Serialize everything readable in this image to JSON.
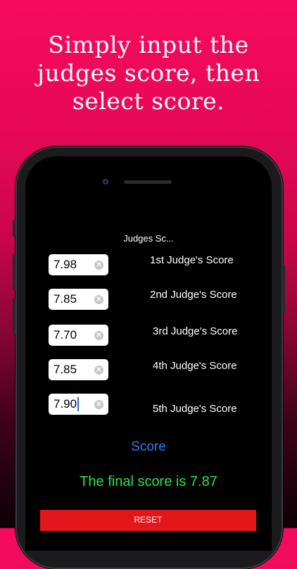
{
  "headline": {
    "line1": "Simply input the",
    "line2": "judges score, then",
    "line3": "select score."
  },
  "nav": {
    "title": "Judges Sc..."
  },
  "judges": [
    {
      "value": "7.98",
      "label": "1st Judge's Score"
    },
    {
      "value": "7.85",
      "label": "2nd Judge's Score"
    },
    {
      "value": "7.70",
      "label": "3rd Judge's Score"
    },
    {
      "value": "7.85",
      "label": "4th Judge's Score"
    },
    {
      "value": "7.90",
      "label": "5th Judge's Score"
    }
  ],
  "clear_icon_glyph": "✕",
  "score_button": "Score",
  "final_score_text": "The final score is 7.87",
  "reset_button": "RESET",
  "colors": {
    "gradient_top": "#f50a5e",
    "score_button": "#2f7cf6",
    "final_text": "#25e83a",
    "reset_bg": "#e3161b"
  }
}
